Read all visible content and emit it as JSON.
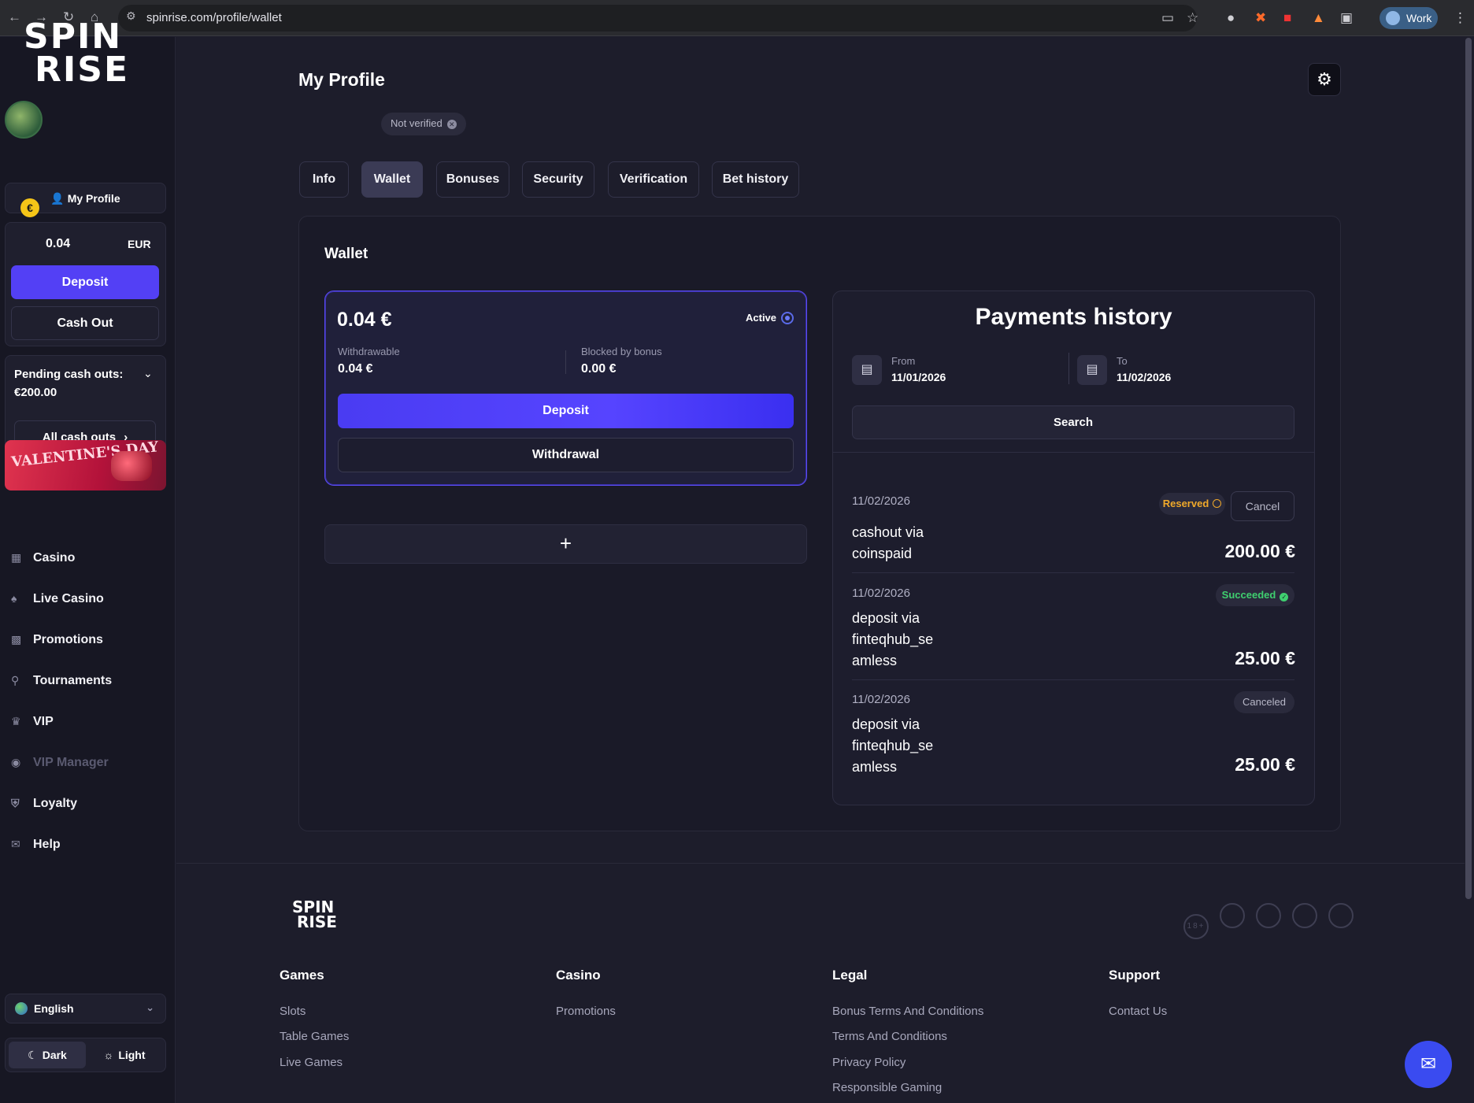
{
  "browser": {
    "url": "spinrise.com/profile/wallet",
    "profile": "Work"
  },
  "sidebar": {
    "logo_line1": "SPIN",
    "logo_line2": "RISE",
    "my_profile": "My Profile",
    "balance": "0.04",
    "currency": "EUR",
    "deposit": "Deposit",
    "cash_out": "Cash Out",
    "pending_label": "Pending cash outs:",
    "pending_amount": "€200.00",
    "all_cash_outs": "All cash outs",
    "banner_text": "VALENTINE'S DAY",
    "menu": [
      {
        "label": "Casino",
        "icon": "cards-icon"
      },
      {
        "label": "Live Casino",
        "icon": "spade-icon"
      },
      {
        "label": "Promotions",
        "icon": "gift-icon"
      },
      {
        "label": "Tournaments",
        "icon": "trophy-icon"
      },
      {
        "label": "VIP",
        "icon": "crown-icon"
      },
      {
        "label": "VIP Manager",
        "icon": "headset-icon"
      },
      {
        "label": "Loyalty",
        "icon": "shield-icon"
      },
      {
        "label": "Help",
        "icon": "mail-icon"
      }
    ],
    "language": "English",
    "theme_dark": "Dark",
    "theme_light": "Light"
  },
  "main": {
    "title": "My Profile",
    "verify_badge": "Not verified",
    "tabs": [
      {
        "label": "Info"
      },
      {
        "label": "Wallet"
      },
      {
        "label": "Bonuses"
      },
      {
        "label": "Security"
      },
      {
        "label": "Verification"
      },
      {
        "label": "Bet history"
      }
    ],
    "active_tab": "Wallet",
    "wallet": {
      "heading": "Wallet",
      "amount": "0.04 €",
      "active_label": "Active",
      "withdrawable_label": "Withdrawable",
      "withdrawable_value": "0.04 €",
      "blocked_label": "Blocked by bonus",
      "blocked_value": "0.00 €",
      "deposit": "Deposit",
      "withdrawal": "Withdrawal",
      "add": "+"
    },
    "payments": {
      "title": "Payments history",
      "from_label": "From",
      "from_value": "11/01/2026",
      "to_label": "To",
      "to_value": "11/02/2026",
      "search": "Search",
      "transactions": [
        {
          "date": "11/02/2026",
          "desc_lines": [
            "cashout via",
            "coinspaid"
          ],
          "amount": "200.00 €",
          "status": "Reserved",
          "action": "Cancel"
        },
        {
          "date": "11/02/2026",
          "desc_lines": [
            "deposit via",
            "finteqhub_se",
            "amless"
          ],
          "amount": "25.00 €",
          "status": "Succeeded"
        },
        {
          "date": "11/02/2026",
          "desc_lines": [
            "deposit via",
            "finteqhub_se",
            "amless"
          ],
          "amount": "25.00 €",
          "status": "Canceled"
        }
      ]
    }
  },
  "footer": {
    "logo_line1": "SPIN",
    "logo_line2": "RISE",
    "badges": [
      "18+",
      "",
      "",
      "",
      ""
    ],
    "columns": [
      {
        "title": "Games",
        "links": [
          "Slots",
          "Table Games",
          "Live Games"
        ]
      },
      {
        "title": "Casino",
        "links": [
          "Promotions"
        ]
      },
      {
        "title": "Legal",
        "links": [
          "Bonus Terms And Conditions",
          "Terms And Conditions",
          "Privacy Policy",
          "Responsible Gaming"
        ]
      },
      {
        "title": "Support",
        "links": [
          "Contact Us"
        ]
      }
    ]
  },
  "colors": {
    "accent": "#5644ff",
    "reserved": "#f0a92a",
    "succeeded": "#3fcf6f",
    "background": "#1d1d2b"
  }
}
